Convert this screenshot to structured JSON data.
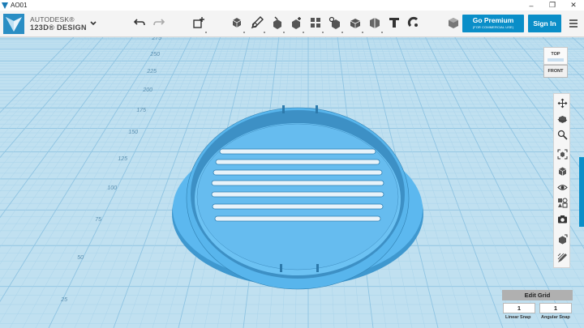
{
  "window": {
    "title": "AO01",
    "minimize_icon": "minimize-icon",
    "maximize_icon": "maximize-icon",
    "close_icon": "close-icon"
  },
  "brand": {
    "line1": "AUTODESK®",
    "line2": "123D® DESIGN"
  },
  "toolbar": {
    "undo_icon": "undo-icon",
    "redo_icon": "redo-icon",
    "tools": [
      "transform",
      "primitives",
      "sketch",
      "construct",
      "modify",
      "pattern",
      "grouping",
      "combine",
      "measure",
      "text",
      "snap",
      "material"
    ]
  },
  "premium": {
    "label": "Go Premium",
    "sublabel": "(FOR COMMERCIAL USE)"
  },
  "signin": {
    "label": "Sign In"
  },
  "viewcube": {
    "top": "TOP",
    "front": "FRONT"
  },
  "ruler": {
    "labels": [
      "275",
      "250",
      "225",
      "200",
      "175",
      "150",
      "125",
      "100",
      "75",
      "50",
      "25"
    ]
  },
  "navbar": {
    "tools": [
      "pan",
      "orbit",
      "zoom",
      "fit",
      "view-mode",
      "visibility",
      "material-view",
      "snapshot",
      "solid-view",
      "sketch-view"
    ]
  },
  "edit_grid": {
    "label": "Edit Grid"
  },
  "linear_snap": {
    "value": "1",
    "label": "Linear Snap"
  },
  "angular_snap": {
    "value": "1",
    "label": "Angular Snap"
  },
  "colors": {
    "accent": "#0a8ec8",
    "model": "#55b6ee",
    "grid_bg": "#c0e0f0"
  }
}
